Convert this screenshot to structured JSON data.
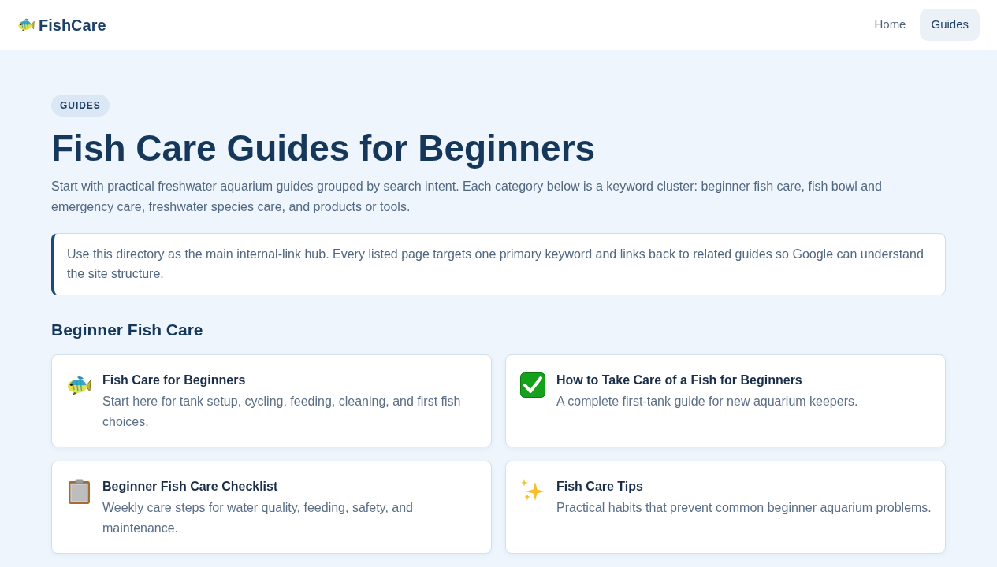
{
  "header": {
    "logo": "FishCare",
    "nav": [
      {
        "label": "Home",
        "selected": false
      },
      {
        "label": "Guides",
        "selected": true
      }
    ]
  },
  "hero": {
    "badge": "GUIDES",
    "title": "Fish Care Guides for Beginners",
    "intro": "Start with practical freshwater aquarium guides grouped by search intent. Each category below is a keyword cluster: beginner fish care, fish bowl and emergency care, freshwater species care, and products or tools.",
    "callout": "Use this directory as the main internal-link hub. Every listed page targets one primary keyword and links back to related guides so Google can understand the site structure."
  },
  "sections": [
    {
      "heading": "Beginner Fish Care",
      "cards": [
        {
          "kind": "fish",
          "title": "Fish Care for Beginners",
          "description": "Start here for tank setup, cycling, feeding, cleaning, and first fish choices."
        },
        {
          "kind": "check",
          "title": "How to Take Care of a Fish for Beginners",
          "description": "A complete first-tank guide for new aquarium keepers."
        },
        {
          "kind": "clipboard",
          "title": "Beginner Fish Care Checklist",
          "description": "Weekly care steps for water quality, feeding, safety, and maintenance."
        },
        {
          "kind": "sparkles",
          "title": "Fish Care Tips",
          "description": "Practical habits that prevent common beginner aquarium problems."
        }
      ]
    }
  ]
}
